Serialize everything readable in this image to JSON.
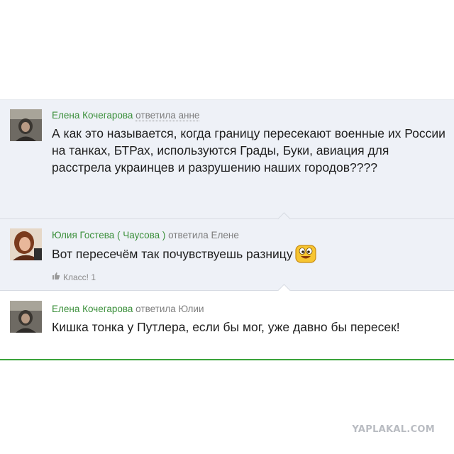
{
  "comments": [
    {
      "author": "Елена Кочегарова",
      "action": "ответила анне",
      "text": "А как это называется, когда границу пересекают военные их России на танках, БТРах, используются  Грады, Буки, авиация для расстрела украинцев и разрушению наших городов????"
    },
    {
      "author": "Юлия Гостева ( Чаусова )",
      "action": "ответила Елене",
      "text": "Вот пересечём так почувствуешь разницу",
      "emoji_icon": "grinning-emoji-icon",
      "likes_label": "Класс! 1"
    },
    {
      "author": "Елена Кочегарова",
      "action": "ответила Юлии",
      "text": "Кишка тонка у Путлера, если бы мог, уже давно бы пересек!"
    }
  ],
  "watermark": "YAPLAKAL.COM",
  "colors": {
    "author": "#3a8f3a",
    "divider_green": "#3ba33b",
    "comment_bg": "#eef1f7"
  }
}
